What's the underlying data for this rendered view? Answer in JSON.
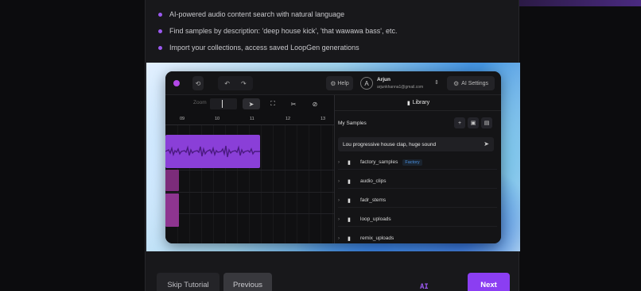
{
  "bullets": [
    "AI-powered audio content search with natural language",
    "Find samples by description: 'deep house kick', 'that wawawa bass', etc.",
    "Import your collections, access saved LoopGen generations"
  ],
  "app": {
    "help_label": "Help",
    "user": {
      "initial": "A",
      "name": "Arjun",
      "email": "arjunkhanna1@gmail.com"
    },
    "ai_settings_label": "AI Settings",
    "zoom_label": "Zoom",
    "ruler_ticks": [
      "09",
      "10",
      "11",
      "12",
      "13"
    ],
    "library_title": "Library",
    "my_samples_label": "My Samples",
    "search_value": "Lou progressive house clap, huge sound",
    "folders": [
      {
        "name": "factory_samples",
        "badge": "Factory"
      },
      {
        "name": "audio_clips"
      },
      {
        "name": "fadr_stems"
      },
      {
        "name": "loop_uploads"
      },
      {
        "name": "remix_uploads"
      }
    ],
    "colors": {
      "accent": "#8b3ef2",
      "clip": "#8a3fd8"
    }
  },
  "footer": {
    "skip_label": "Skip Tutorial",
    "previous_label": "Previous",
    "next_label": "Next",
    "brand_mark": "AI"
  }
}
